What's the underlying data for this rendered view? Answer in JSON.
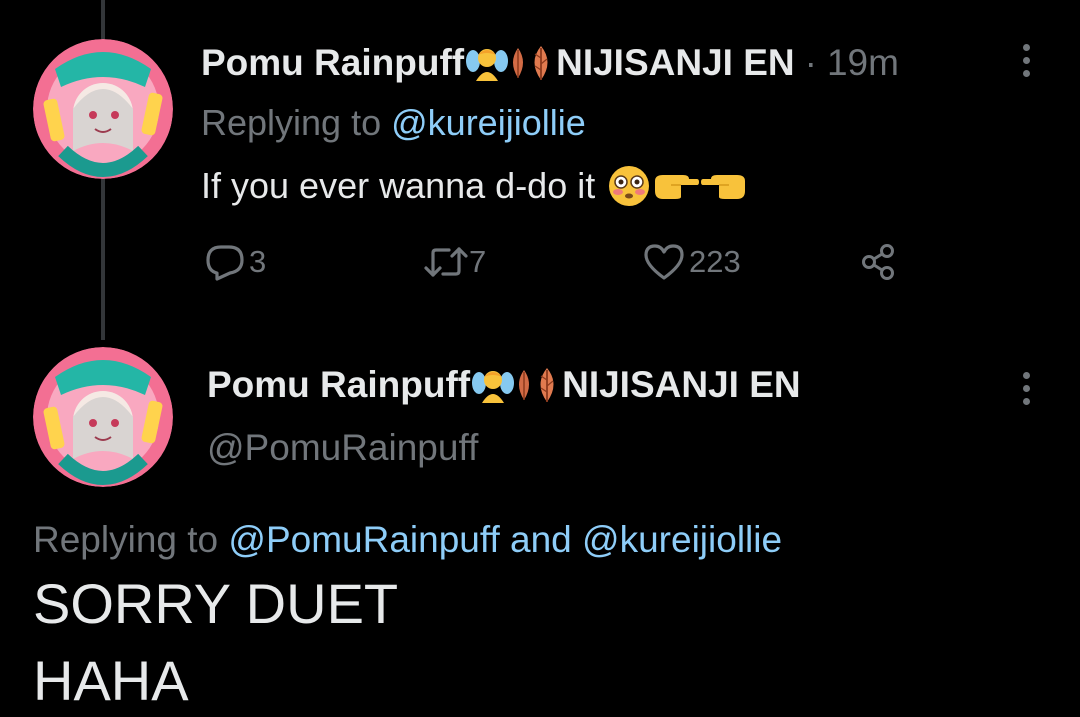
{
  "first_tweet": {
    "display_name": "Pomu Rainpuff",
    "org_name": "NIJISANJI EN",
    "separator": "·",
    "time": "19m",
    "replying_to_prefix": "Replying to",
    "replying_to_handle": "@kureijiollie",
    "text": "If you ever wanna d-do it",
    "text_emoji_icons": [
      "flushed-face-icon",
      "pointing-right-hand-icon",
      "pointing-left-hand-icon"
    ],
    "actions": {
      "reply_count": "3",
      "retweet_count": "7",
      "like_count": "223"
    }
  },
  "main_tweet": {
    "display_name": "Pomu Rainpuff",
    "org_name": "NIJISANJI EN",
    "handle": "@PomuRainpuff",
    "replying_to_prefix": "Replying to",
    "replying_to_handle_1": "@PomuRainpuff",
    "replying_to_and": "and",
    "replying_to_handle_2": "@kureijiollie",
    "text_line_1": "SORRY DUET",
    "text_line_2": "HAHA"
  },
  "name_emoji_icons": [
    "fairy-emoji-icon",
    "leaf-icon",
    "leaf-icon"
  ],
  "colors": {
    "background": "#000000",
    "text": "#e7e9ea",
    "muted": "#71767b",
    "link": "#8ecdf8",
    "thread_line": "#333639"
  }
}
